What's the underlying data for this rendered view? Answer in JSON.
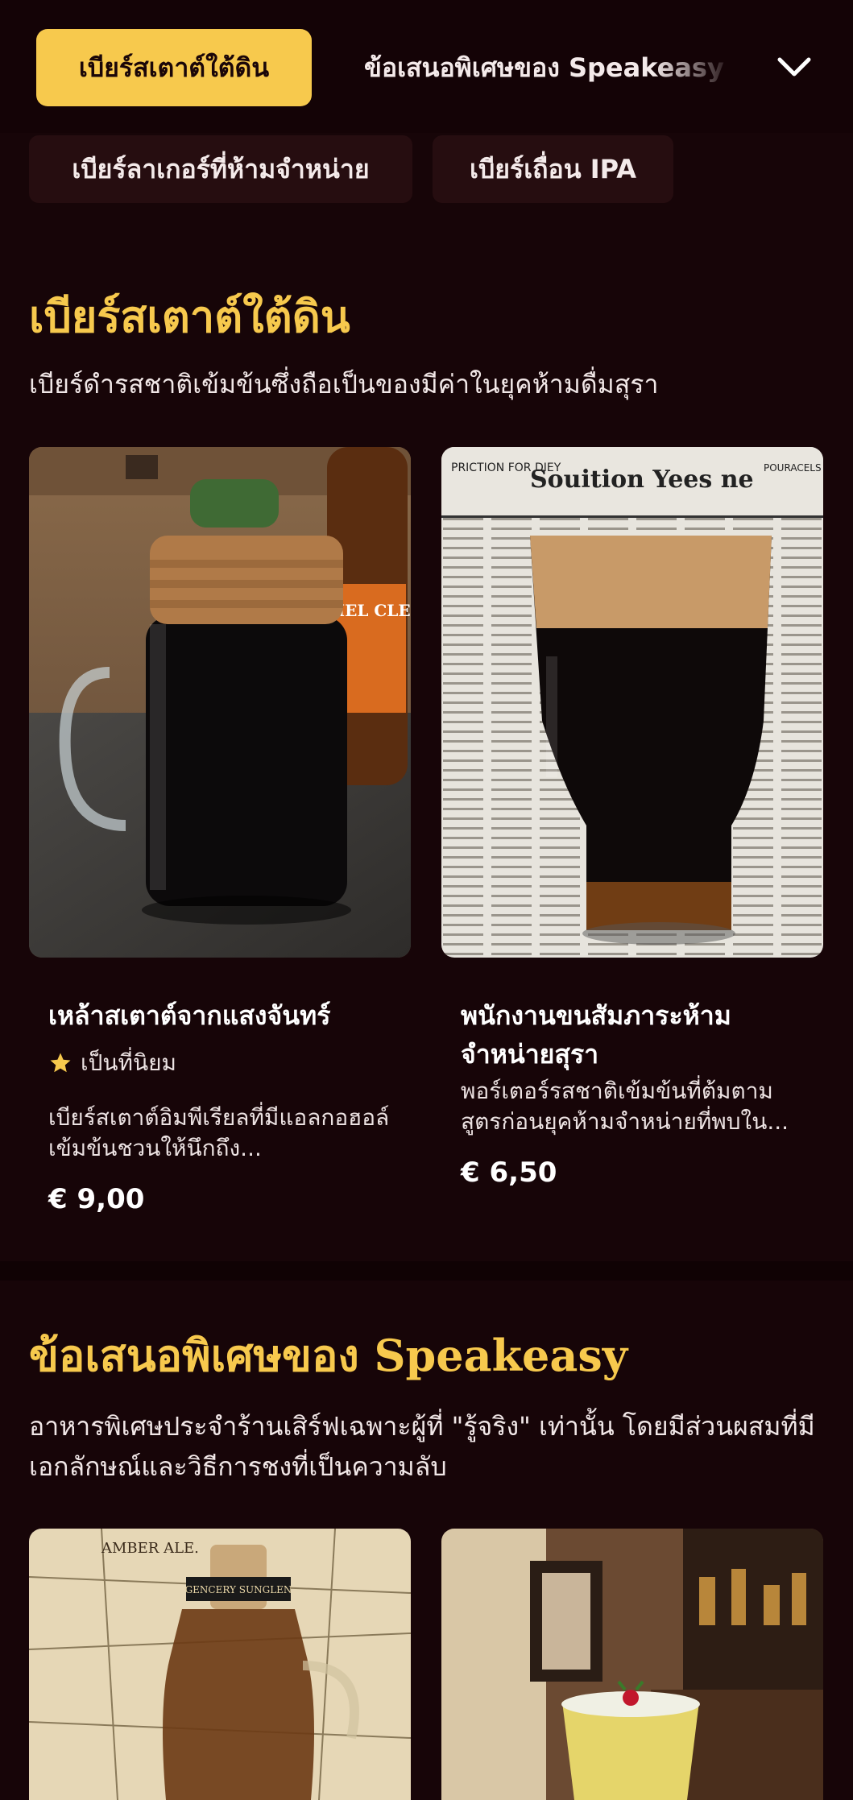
{
  "nav": {
    "active_tab": "เบียร์สเตาต์ใต้ดิน",
    "second_tab": "ข้อเสนอพิเศษของ Speakeasy",
    "chips": [
      "เบียร์ลาเกอร์ที่ห้ามจำหน่าย",
      "เบียร์เถื่อน IPA"
    ]
  },
  "sections": [
    {
      "title": "เบียร์สเตาต์ใต้ดิน",
      "subtitle": "เบียร์ดำรสชาติเข้มข้นซึ่งถือเป็นของมีค่าในยุคห้ามดื่มสุรา",
      "items": [
        {
          "name": "เหล้าสเตาต์จากแสงจันทร์",
          "badge": "เป็นที่นิยม",
          "description": "เบียร์สเตาต์อิมพีเรียลที่มีแอลกอฮอล์เข้มข้นชวนให้นึกถึง...",
          "price": "€ 9,00"
        },
        {
          "name": "พนักงานขนสัมภาระห้ามจำหน่ายสุรา",
          "description": "พอร์เตอร์รสชาติเข้มข้นที่ต้มตามสูตรก่อนยุคห้ามจำหน่ายที่พบใน...",
          "price": "€ 6,50"
        }
      ]
    },
    {
      "title": "ข้อเสนอพิเศษของ Speakeasy",
      "subtitle": "อาหารพิเศษประจำร้านเสิร์ฟเฉพาะผู้ที่ \"รู้จริง\" เท่านั้น โดยมีส่วนผสมที่มีเอกลักษณ์และวิธีการชงที่เป็นความลับ"
    }
  ],
  "image_text": {
    "newspaper_headline": "Souition Yees ne",
    "newspaper_left": "PRICTION FOR DIEY",
    "newspaper_right": "POURACELS",
    "can_label": "CORMEL CLEMIT",
    "map_label": "AMBER ALE.",
    "bottle_label": "GENCERY SUNGLEN"
  },
  "colors": {
    "background": "#170508",
    "accent": "#f7c94d",
    "chip_bg": "#260d10"
  }
}
